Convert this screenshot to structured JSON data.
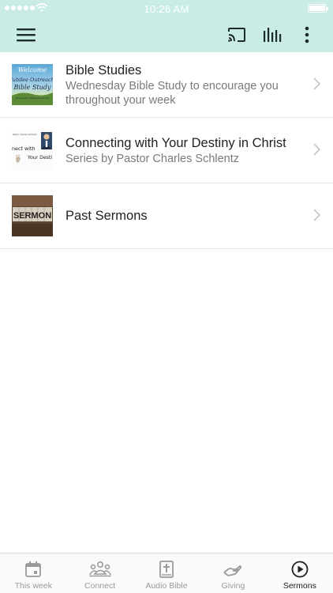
{
  "status_bar": {
    "time": "10:26 AM"
  },
  "rows": [
    {
      "title": "Bible Studies",
      "subtitle": "Wednesday Bible Study to encourage you throughout your week",
      "thumb_text": [
        "Welcome",
        "Jubilee Outreach",
        "Bible Study",
        "Join us every Wednesday at 7pm"
      ]
    },
    {
      "title": "Connecting with Your Destiny in Christ",
      "subtitle": "Series by Pastor Charles Schlentz",
      "thumb_text": [
        "Pastor Charles Schlentz",
        "nect with",
        "Your Desti"
      ]
    },
    {
      "title": "Past Sermons",
      "subtitle": "",
      "thumb_text": [
        "SERMON"
      ]
    }
  ],
  "tabs": [
    {
      "label": "This week",
      "icon": "calendar-icon",
      "active": false
    },
    {
      "label": "Connect",
      "icon": "people-icon",
      "active": false
    },
    {
      "label": "Audio Bible",
      "icon": "bible-icon",
      "active": false
    },
    {
      "label": "Giving",
      "icon": "giving-hand-icon",
      "active": false
    },
    {
      "label": "Sermons",
      "icon": "play-circle-icon",
      "active": true
    }
  ],
  "colors": {
    "header_bg": "#c9ece6",
    "active_tab": "#222222",
    "inactive_tab": "#9a9a9a"
  }
}
